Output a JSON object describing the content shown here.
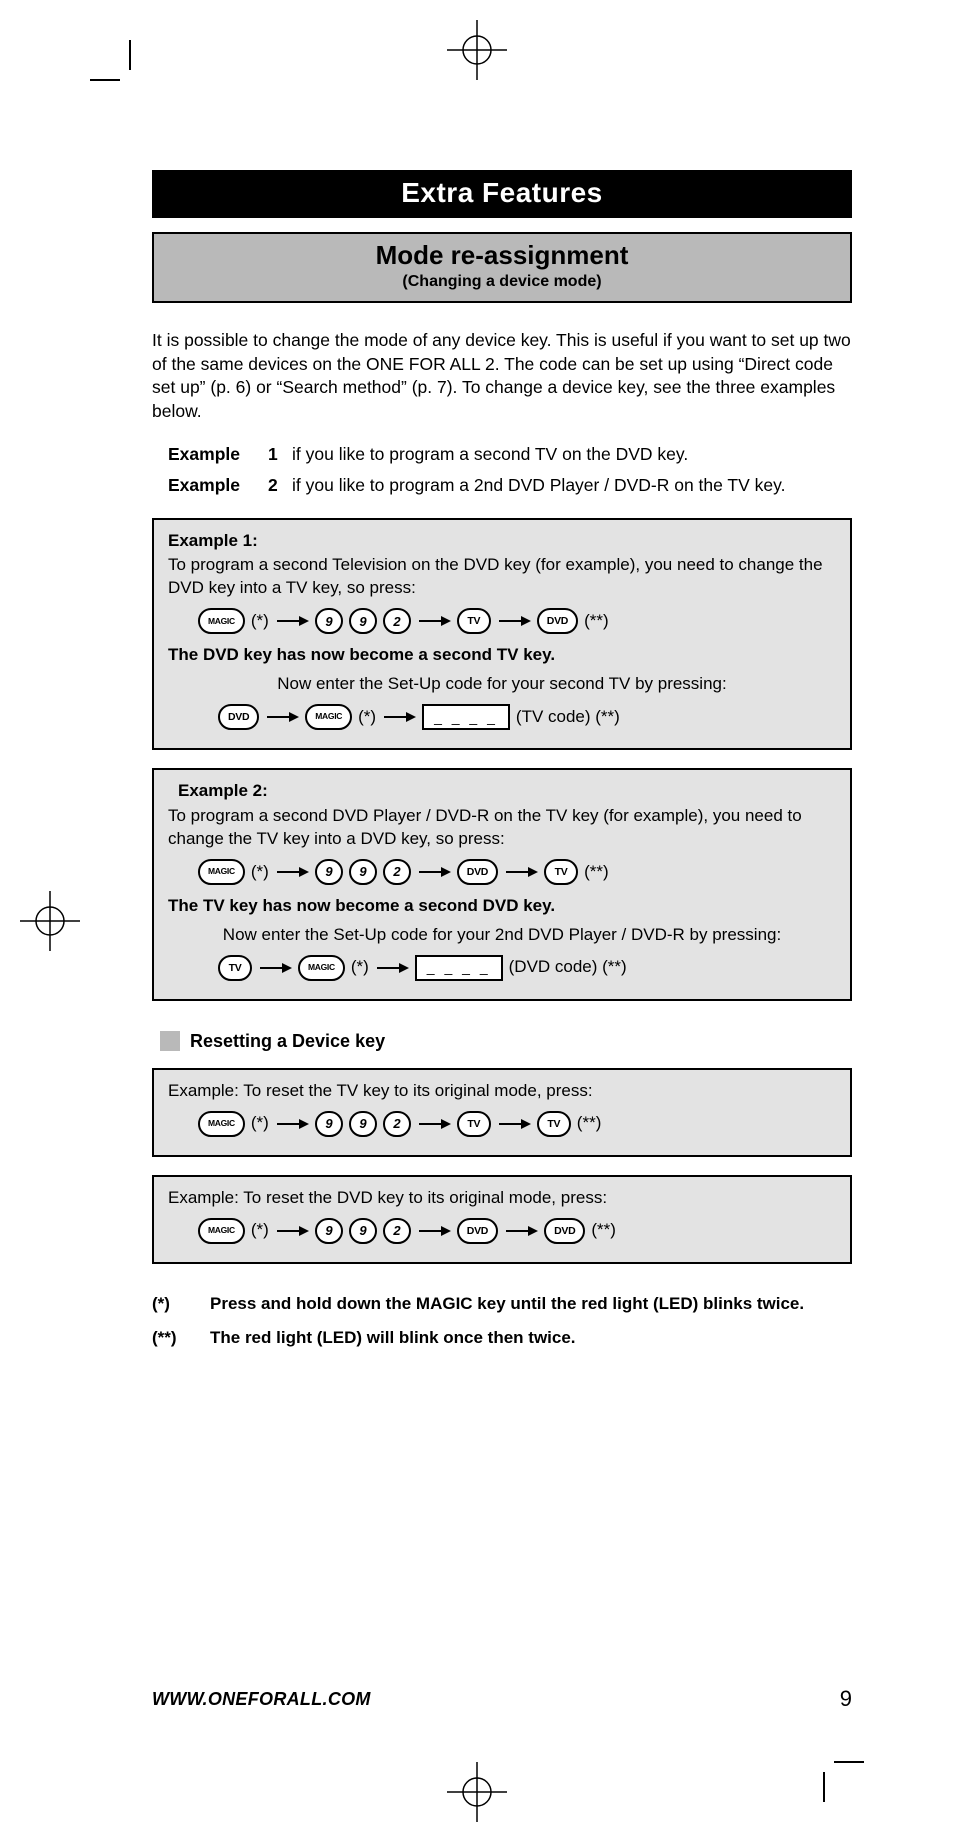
{
  "header": {
    "title": "Extra Features",
    "subtitle": "Mode re-assignment",
    "subcaption": "(Changing a device mode)"
  },
  "intro": "It is possible to change the mode of any device key. This is useful if you want to set up two of the same devices on the ONE FOR ALL 2. The code can be set up using “Direct code set up” (p. 6) or “Search method” (p. 7). To change a device key, see the three examples below.",
  "example_list": {
    "label": "Example",
    "items": [
      {
        "n": "1",
        "text": "if you like to program a second TV on the DVD key."
      },
      {
        "n": "2",
        "text": "if you like to program a 2nd DVD Player / DVD-R on the TV key."
      }
    ]
  },
  "box1": {
    "header": "Example 1:",
    "text": "To program a second Television on the DVD key (for example), you need to change the DVD key into a TV key, so press:",
    "seq": {
      "k_magic": "MAGIC",
      "star": "(*)",
      "d1": "9",
      "d2": "9",
      "d3": "2",
      "k_tv": "TV",
      "k_dvd": "DVD",
      "dstar": "(**)"
    },
    "result": "The DVD key has now become a second TV key.",
    "line2": "Now enter the Set-Up code for your second TV by pressing:",
    "seq2": {
      "k_dvd": "DVD",
      "k_magic": "MAGIC",
      "star": "(*)",
      "code": "_ _ _ _",
      "tail": "(TV code) (**)"
    }
  },
  "box2": {
    "header": "Example 2:",
    "text": "To program a second DVD Player / DVD-R on the TV key (for example), you need to change the TV key into a DVD key, so press:",
    "seq": {
      "k_magic": "MAGIC",
      "star": "(*)",
      "d1": "9",
      "d2": "9",
      "d3": "2",
      "k_dvd": "DVD",
      "k_tv": "TV",
      "dstar": "(**)"
    },
    "result": "The TV key has now become a second DVD key.",
    "line2": "Now enter the Set-Up code for your 2nd DVD Player / DVD-R by pressing:",
    "seq2": {
      "k_tv": "TV",
      "k_magic": "MAGIC",
      "star": "(*)",
      "code": "_ _ _ _",
      "tail": "(DVD code) (**)"
    }
  },
  "reset": {
    "heading": "Resetting a Device key",
    "box_a": {
      "text": "Example: To reset the TV key to its original mode, press:",
      "seq": {
        "k_magic": "MAGIC",
        "star": "(*)",
        "d1": "9",
        "d2": "9",
        "d3": "2",
        "k1": "TV",
        "k2": "TV",
        "dstar": "(**)"
      }
    },
    "box_b": {
      "text": "Example: To reset the DVD key to its original mode, press:",
      "seq": {
        "k_magic": "MAGIC",
        "star": "(*)",
        "d1": "9",
        "d2": "9",
        "d3": "2",
        "k1": "DVD",
        "k2": "DVD",
        "dstar": "(**)"
      }
    }
  },
  "footnotes": {
    "a": {
      "mark": "(*)",
      "text": "Press and hold down the MAGIC key until the red light (LED) blinks twice."
    },
    "b": {
      "mark": "(**)",
      "text": "The red light (LED) will blink once then twice."
    }
  },
  "footer": {
    "url": "WWW.ONEFORALL.COM",
    "page": "9"
  }
}
